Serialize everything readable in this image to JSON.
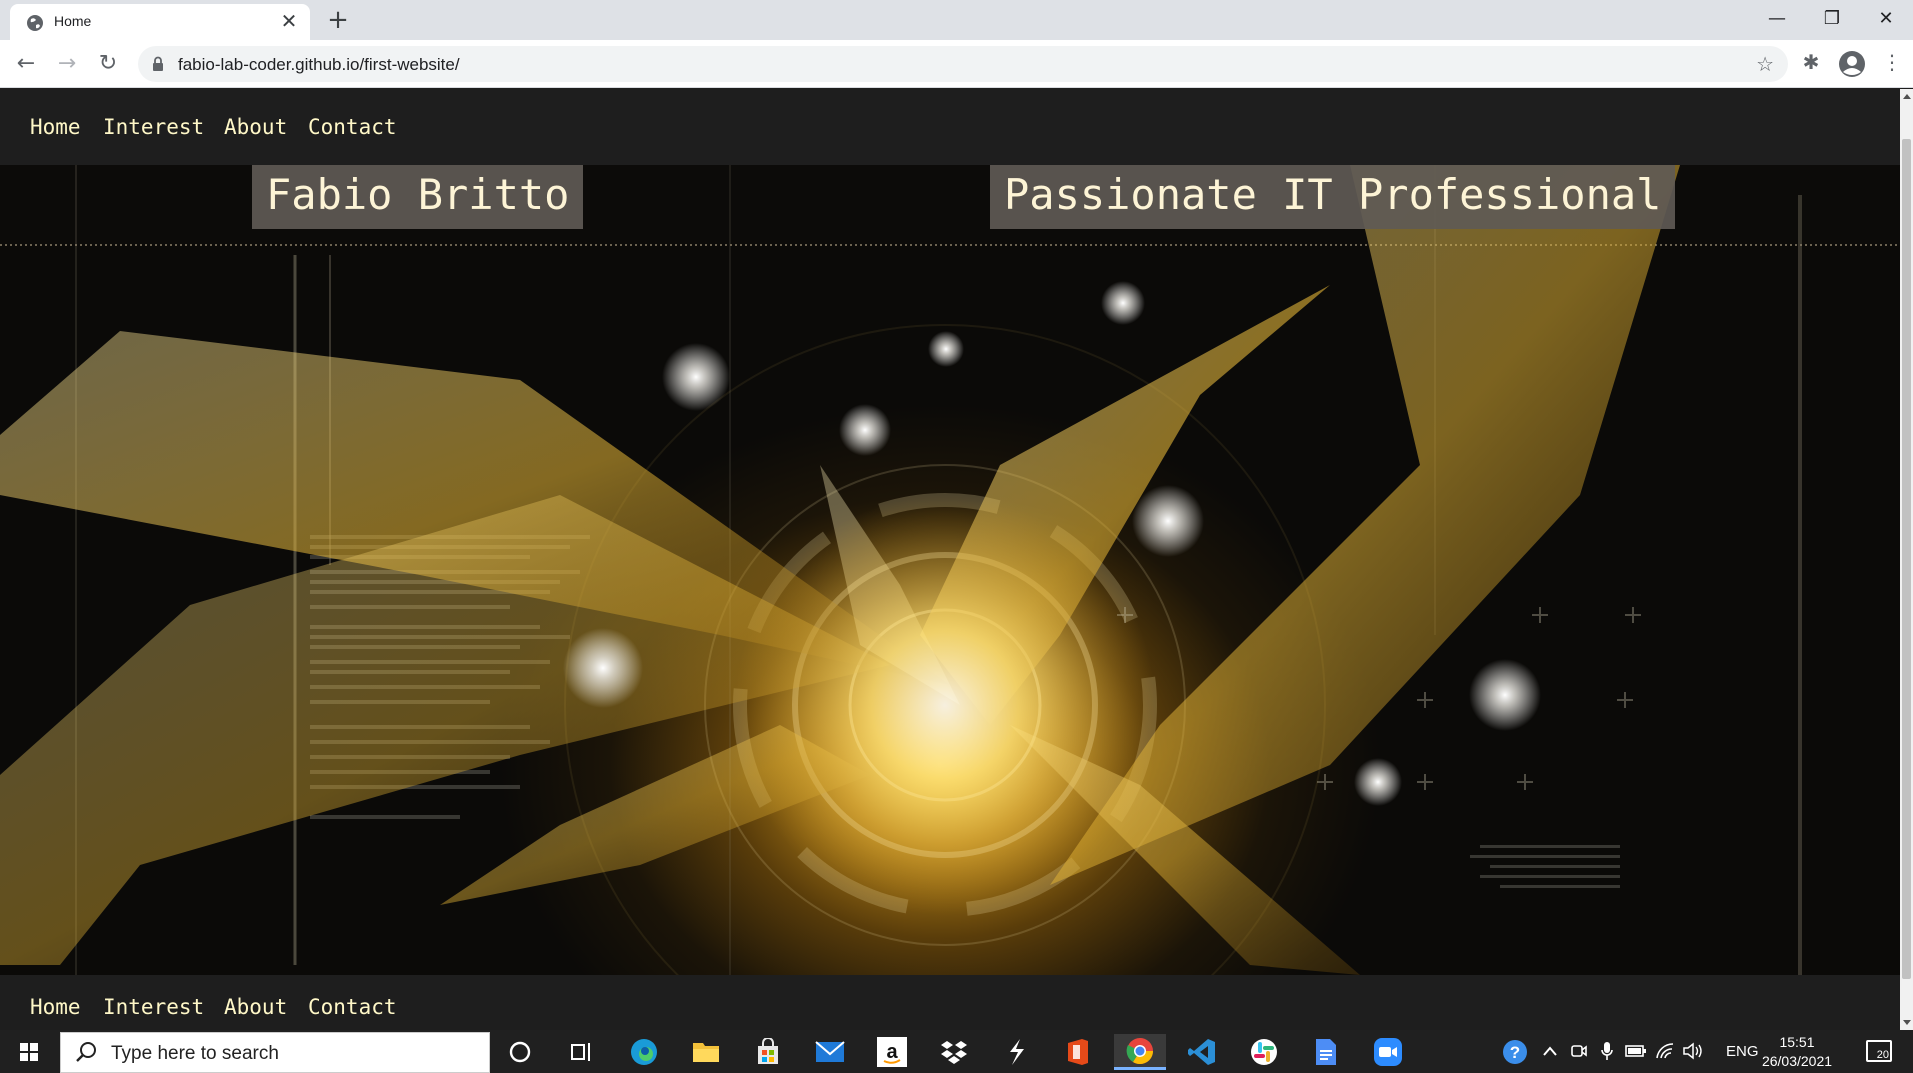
{
  "browser": {
    "tab_title": "Home",
    "tab_close": "✕",
    "new_tab": "+",
    "url": "fabio-lab-coder.github.io/first-website/",
    "window": {
      "minimize": "—",
      "restore": "❐",
      "close": "✕"
    },
    "nav": {
      "back": "←",
      "forward": "→",
      "reload": "↻",
      "star": "☆",
      "extensions": "✱",
      "menu": "⋮"
    }
  },
  "site": {
    "nav_top": [
      "Home",
      "Interest",
      "About",
      "Contact"
    ],
    "nav_bottom": [
      "Home",
      "Interest",
      "About",
      "Contact"
    ],
    "hero": {
      "name": "Fabio Britto",
      "tagline": "Passionate IT Professional"
    }
  },
  "taskbar": {
    "search_placeholder": "Type here to search",
    "apps": [
      {
        "name": "cortana",
        "color": "#202020"
      },
      {
        "name": "task-view",
        "color": "#202020"
      },
      {
        "name": "edge",
        "color": "#2aa6d8"
      },
      {
        "name": "file-explorer",
        "color": "#f3c13a"
      },
      {
        "name": "microsoft-store",
        "color": "#f5f5f5"
      },
      {
        "name": "mail",
        "color": "#1f7ad8"
      },
      {
        "name": "amazon",
        "color": "#ffffff"
      },
      {
        "name": "dropbox",
        "color": "#ffffff"
      },
      {
        "name": "vs-studio",
        "color": "#ffffff"
      },
      {
        "name": "office",
        "color": "#e64a19"
      },
      {
        "name": "chrome",
        "color": "#e8453c"
      },
      {
        "name": "vscode",
        "color": "#2b8fd6"
      },
      {
        "name": "slack",
        "color": "#ffffff"
      },
      {
        "name": "docs",
        "color": "#4d8df5"
      },
      {
        "name": "zoom",
        "color": "#2d8cff"
      }
    ],
    "tray": {
      "language": "ENG",
      "time": "15:51",
      "date": "26/03/2021",
      "notifications": "20"
    }
  }
}
